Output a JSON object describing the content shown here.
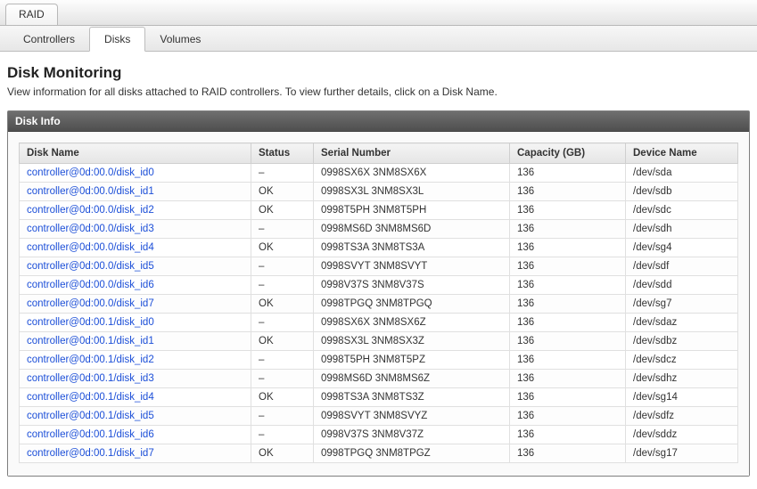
{
  "topTab": {
    "label": "RAID"
  },
  "subTabs": [
    {
      "label": "Controllers",
      "active": false
    },
    {
      "label": "Disks",
      "active": true
    },
    {
      "label": "Volumes",
      "active": false
    }
  ],
  "page": {
    "title": "Disk Monitoring",
    "subtitle": "View information for all disks attached to RAID controllers. To view further details, click on a Disk Name."
  },
  "panel": {
    "title": "Disk Info"
  },
  "table": {
    "columns": [
      "Disk Name",
      "Status",
      "Serial Number",
      "Capacity (GB)",
      "Device Name"
    ],
    "rows": [
      {
        "name": "controller@0d:00.0/disk_id0",
        "status": "–",
        "serial": "0998SX6X 3NM8SX6X",
        "capacity": "136",
        "device": "/dev/sda"
      },
      {
        "name": "controller@0d:00.0/disk_id1",
        "status": "OK",
        "serial": "0998SX3L 3NM8SX3L",
        "capacity": "136",
        "device": "/dev/sdb"
      },
      {
        "name": "controller@0d:00.0/disk_id2",
        "status": "OK",
        "serial": "0998T5PH 3NM8T5PH",
        "capacity": "136",
        "device": "/dev/sdc"
      },
      {
        "name": "controller@0d:00.0/disk_id3",
        "status": "–",
        "serial": "0998MS6D 3NM8MS6D",
        "capacity": "136",
        "device": "/dev/sdh"
      },
      {
        "name": "controller@0d:00.0/disk_id4",
        "status": "OK",
        "serial": "0998TS3A 3NM8TS3A",
        "capacity": "136",
        "device": "/dev/sg4"
      },
      {
        "name": "controller@0d:00.0/disk_id5",
        "status": "–",
        "serial": "0998SVYT 3NM8SVYT",
        "capacity": "136",
        "device": "/dev/sdf"
      },
      {
        "name": "controller@0d:00.0/disk_id6",
        "status": "–",
        "serial": "0998V37S 3NM8V37S",
        "capacity": "136",
        "device": "/dev/sdd"
      },
      {
        "name": "controller@0d:00.0/disk_id7",
        "status": "OK",
        "serial": "0998TPGQ 3NM8TPGQ",
        "capacity": "136",
        "device": "/dev/sg7"
      },
      {
        "name": "controller@0d:00.1/disk_id0",
        "status": "–",
        "serial": "0998SX6X 3NM8SX6Z",
        "capacity": "136",
        "device": "/dev/sdaz"
      },
      {
        "name": "controller@0d:00.1/disk_id1",
        "status": "OK",
        "serial": "0998SX3L 3NM8SX3Z",
        "capacity": "136",
        "device": "/dev/sdbz"
      },
      {
        "name": "controller@0d:00.1/disk_id2",
        "status": "–",
        "serial": "0998T5PH 3NM8T5PZ",
        "capacity": "136",
        "device": "/dev/sdcz"
      },
      {
        "name": "controller@0d:00.1/disk_id3",
        "status": "–",
        "serial": "0998MS6D 3NM8MS6Z",
        "capacity": "136",
        "device": "/dev/sdhz"
      },
      {
        "name": "controller@0d:00.1/disk_id4",
        "status": "OK",
        "serial": "0998TS3A 3NM8TS3Z",
        "capacity": "136",
        "device": "/dev/sg14"
      },
      {
        "name": "controller@0d:00.1/disk_id5",
        "status": "–",
        "serial": "0998SVYT 3NM8SVYZ",
        "capacity": "136",
        "device": "/dev/sdfz"
      },
      {
        "name": "controller@0d:00.1/disk_id6",
        "status": "–",
        "serial": "0998V37S 3NM8V37Z",
        "capacity": "136",
        "device": "/dev/sddz"
      },
      {
        "name": "controller@0d:00.1/disk_id7",
        "status": "OK",
        "serial": "0998TPGQ 3NM8TPGZ",
        "capacity": "136",
        "device": "/dev/sg17"
      }
    ]
  }
}
